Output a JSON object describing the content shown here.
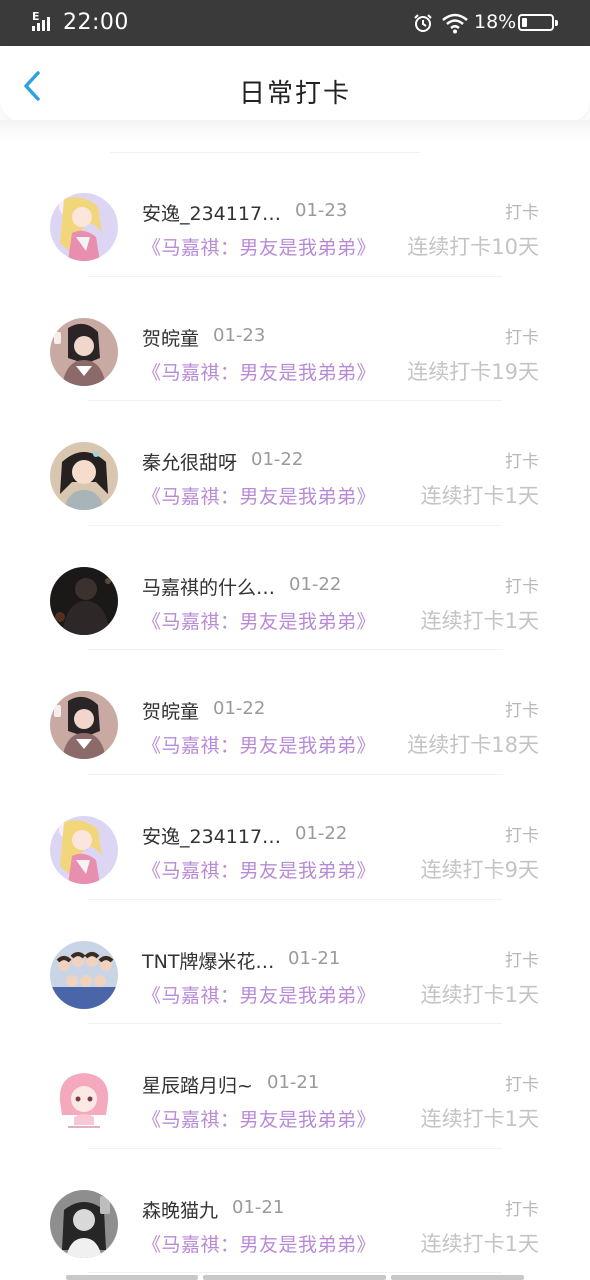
{
  "status_bar": {
    "signal_label": "E",
    "time": "22:00",
    "battery_percent": "18%",
    "battery_level": 0.18,
    "icons": [
      "signal-icon",
      "alarm-icon",
      "wifi-icon",
      "battery-icon"
    ]
  },
  "nav": {
    "title": "日常打卡",
    "back_icon": "chevron-left-icon",
    "accent_color": "#2aa3e0"
  },
  "colors": {
    "book_title": "#b98bd6",
    "meta": "#9a9a9a"
  },
  "entries": [
    {
      "name": "安逸_234117…",
      "date": "01-23",
      "tag": "打卡",
      "book": "《马嘉祺：男友是我弟弟》",
      "streak": "连续打卡10天",
      "avatar": "anime-girl-avatar"
    },
    {
      "name": "贺皖童",
      "date": "01-23",
      "tag": "打卡",
      "book": "《马嘉祺：男友是我弟弟》",
      "streak": "连续打卡19天",
      "avatar": "girl-selfie-avatar"
    },
    {
      "name": "秦允很甜呀",
      "date": "01-22",
      "tag": "打卡",
      "book": "《马嘉祺：男友是我弟弟》",
      "streak": "连续打卡1天",
      "avatar": "girl-portrait-avatar"
    },
    {
      "name": "马嘉祺的什么…",
      "date": "01-22",
      "tag": "打卡",
      "book": "《马嘉祺：男友是我弟弟》",
      "streak": "连续打卡1天",
      "avatar": "dark-photo-avatar"
    },
    {
      "name": "贺皖童",
      "date": "01-22",
      "tag": "打卡",
      "book": "《马嘉祺：男友是我弟弟》",
      "streak": "连续打卡18天",
      "avatar": "girl-selfie-avatar"
    },
    {
      "name": "安逸_234117…",
      "date": "01-22",
      "tag": "打卡",
      "book": "《马嘉祺：男友是我弟弟》",
      "streak": "连续打卡9天",
      "avatar": "anime-girl-avatar"
    },
    {
      "name": "TNT牌爆米花…",
      "date": "01-21",
      "tag": "打卡",
      "book": "《马嘉祺：男友是我弟弟》",
      "streak": "连续打卡1天",
      "avatar": "group-photo-avatar"
    },
    {
      "name": "星辰踏月归~",
      "date": "01-21",
      "tag": "打卡",
      "book": "《马嘉祺：男友是我弟弟》",
      "streak": "连续打卡1天",
      "avatar": "pink-cartoon-avatar"
    },
    {
      "name": "森晚猫九",
      "date": "01-21",
      "tag": "打卡",
      "book": "《马嘉祺：男友是我弟弟》",
      "streak": "连续打卡1天",
      "avatar": "mono-photo-avatar"
    }
  ]
}
